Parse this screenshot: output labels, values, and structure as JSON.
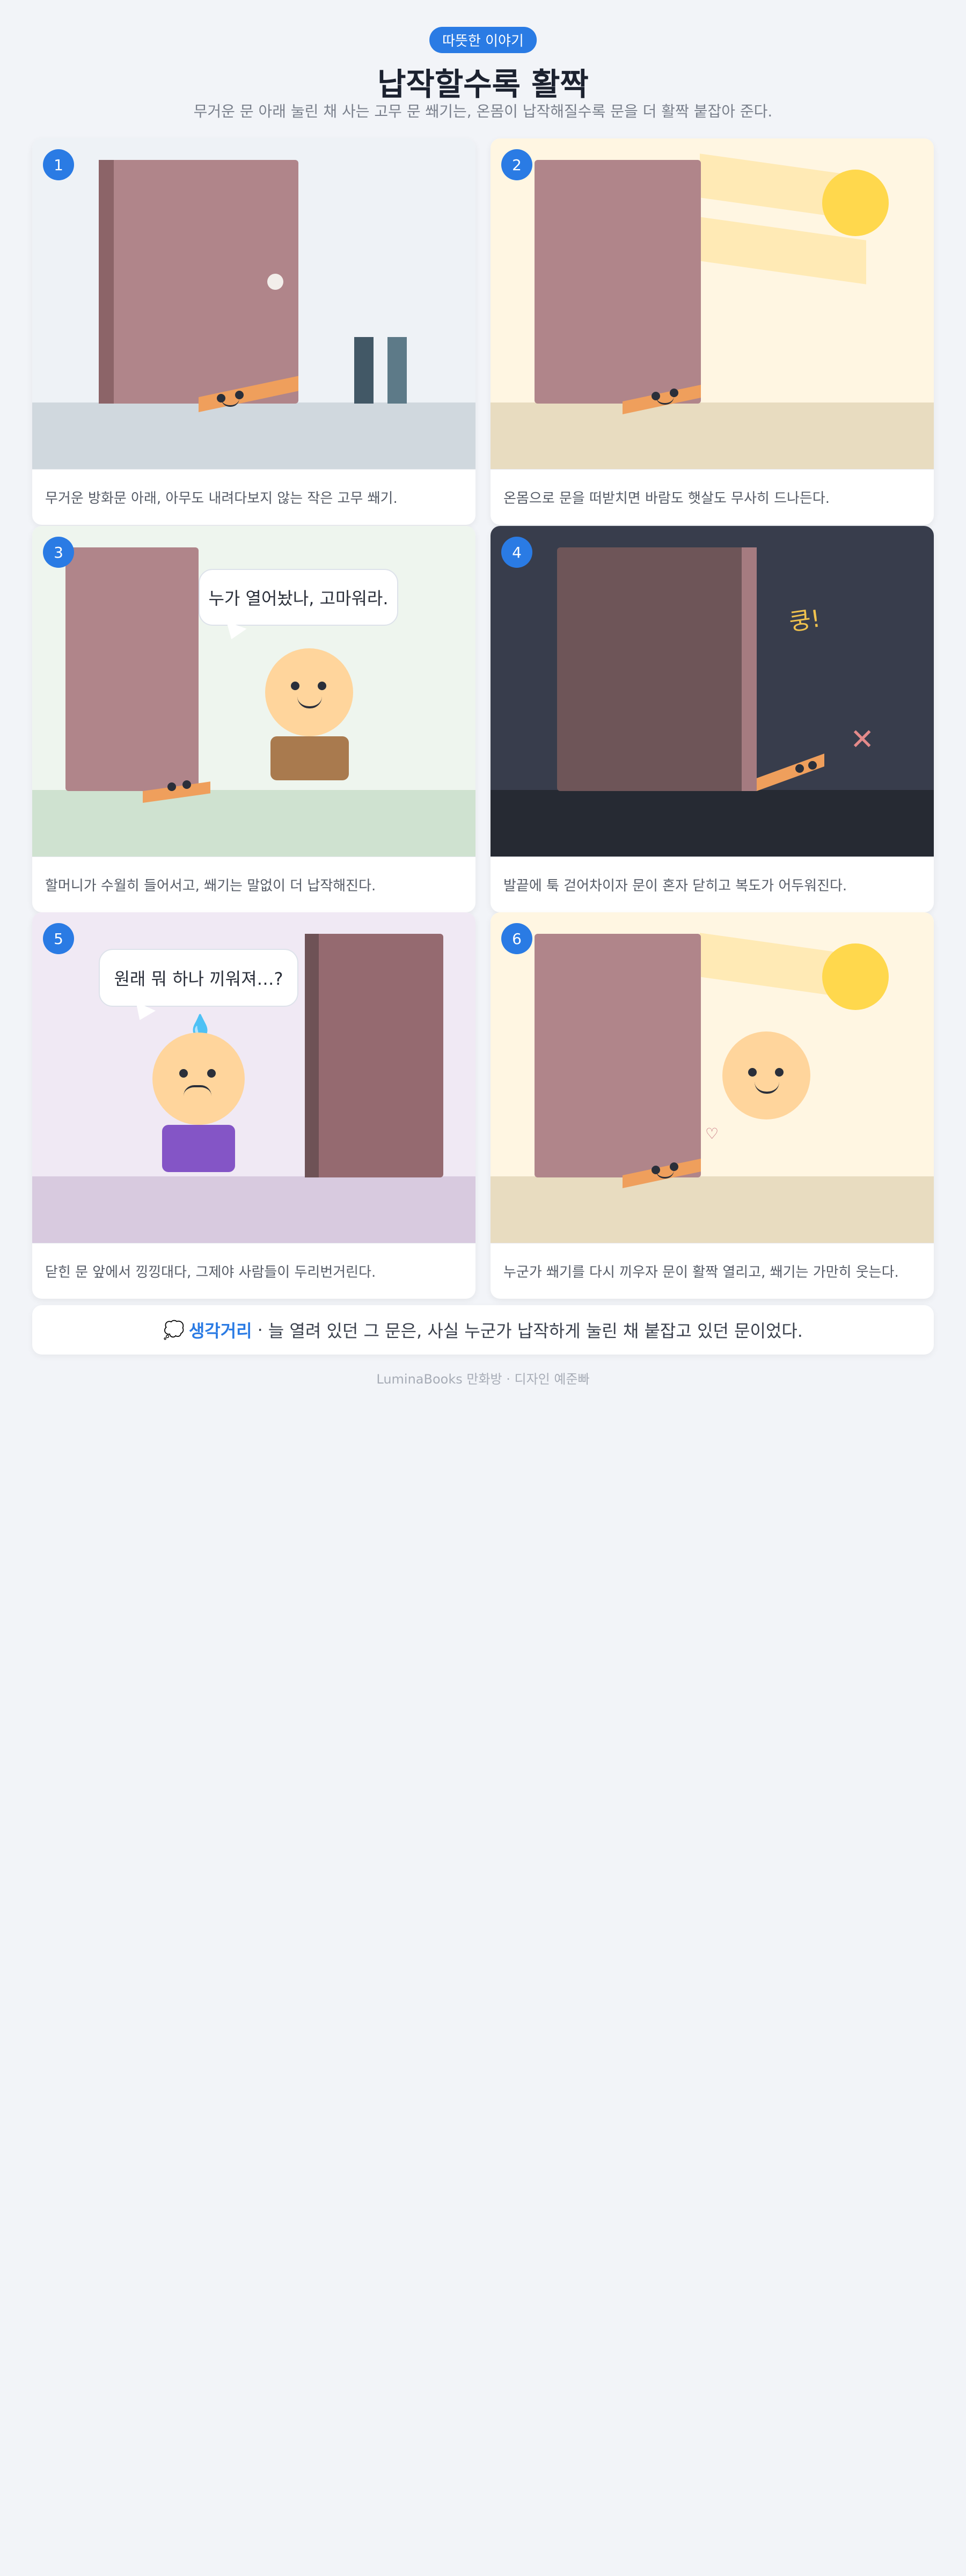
{
  "header": {
    "badge": "따뜻한 이야기",
    "title": "납작할수록 활짝",
    "subtitle": "무거운 문 아래 눌린 채 사는 고무 문 쐐기는, 온몸이 납작해질수록 문을 더 활짝 붙잡아 준다."
  },
  "panels": [
    {
      "number": "1",
      "caption": "무거운 방화문 아래, 아무도 내려다보지 않는 작은 고무 쐐기."
    },
    {
      "number": "2",
      "caption": "온몸으로 문을 떠받치면 바람도 햇살도 무사히 드나든다."
    },
    {
      "number": "3",
      "caption": "할머니가 수월히 들어서고, 쐐기는 말없이 더 납작해진다.",
      "speech": "누가 열어놨나, 고마워라."
    },
    {
      "number": "4",
      "caption": "발끝에 툭 걷어차이자 문이 혼자 닫히고 복도가 어두워진다.",
      "sfx": "쿵!"
    },
    {
      "number": "5",
      "caption": "닫힌 문 앞에서 낑낑대다, 그제야 사람들이 두리번거린다.",
      "speech": "원래 뭐 하나 끼워져…?"
    },
    {
      "number": "6",
      "caption": "누군가 쐐기를 다시 끼우자 문이 활짝 열리고, 쐐기는 가만히 웃는다.",
      "heart": "♡"
    }
  ],
  "reflection": {
    "label": "생각거리",
    "separator": "·",
    "text": "늘 열려 있던 그 문은, 사실 누군가 납작하게 눌린 채 붙잡고 있던 문이었다."
  },
  "footer": "LuminaBooks 만화방 · 디자인 예준빠",
  "colors": {
    "accent": "#2a7be4",
    "door": "#b0858a",
    "wedge": "#ef9f5c",
    "sun": "#ffd84d",
    "page_bg": "#f2f4f8"
  },
  "icons": [
    "thought-bubble-icon",
    "sweat-drop-icon",
    "heart-icon",
    "impact-x-icon"
  ]
}
